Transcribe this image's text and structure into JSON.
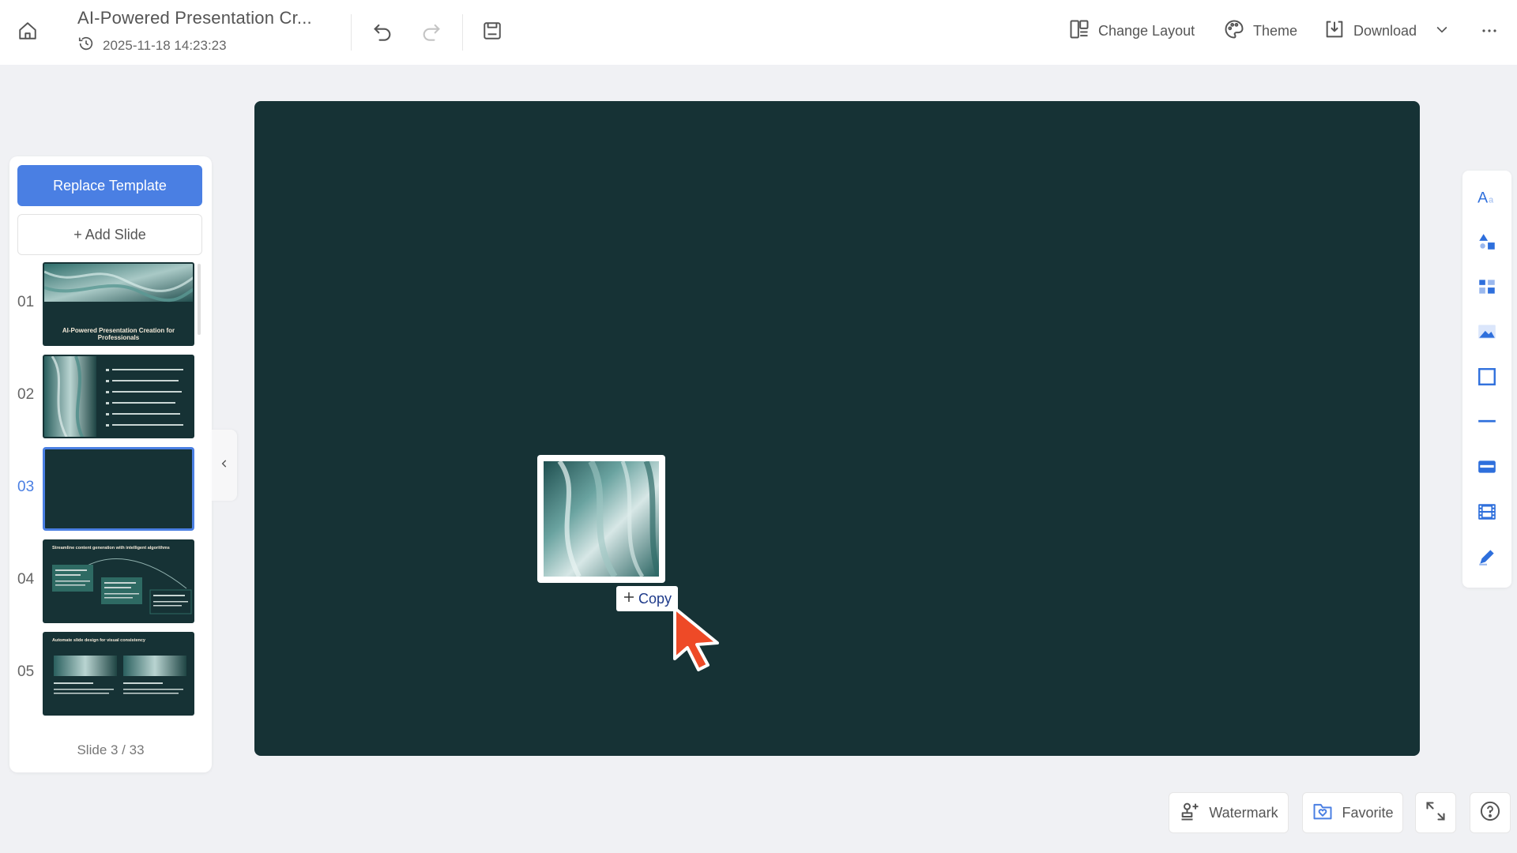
{
  "header": {
    "title": "AI-Powered Presentation Cr...",
    "timestamp": "2025-11-18 14:23:23",
    "actions": {
      "change_layout": "Change Layout",
      "theme": "Theme",
      "download": "Download"
    }
  },
  "sidebar": {
    "replace_template": "Replace Template",
    "add_slide": "+ Add Slide",
    "slides": [
      {
        "num": "01",
        "title": "AI-Powered Presentation Creation for Professionals"
      },
      {
        "num": "02",
        "title": ""
      },
      {
        "num": "03",
        "title": ""
      },
      {
        "num": "04",
        "title": "Streamline content generation with intelligent algorithms"
      },
      {
        "num": "05",
        "title": "Automate slide design for visual consistency"
      }
    ],
    "active_index": 2,
    "slide_count": "Slide 3 / 33"
  },
  "canvas": {
    "copy_label": "Copy",
    "background": "#163235"
  },
  "right_toolbar": [
    "text-icon",
    "shapes-icon",
    "elements-icon",
    "image-icon",
    "frame-icon",
    "line-icon",
    "table-icon",
    "video-icon",
    "draw-icon"
  ],
  "bottom": {
    "watermark": "Watermark",
    "favorite": "Favorite"
  },
  "colors": {
    "accent": "#4a7fe3",
    "slide_bg": "#163235",
    "cursor": "#ee4a27"
  }
}
